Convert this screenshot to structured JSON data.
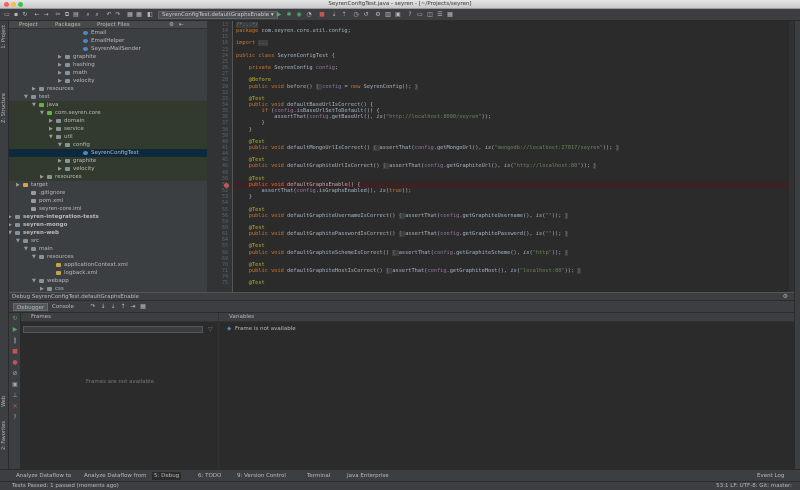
{
  "window": {
    "title": "SeyrenConfigTest.java - seyren - [~/Projects/seyren]"
  },
  "toolbar": {
    "run_config": "SeyrenConfigTest.defaultGraphsEnable ▾"
  },
  "left_strip": {
    "project_tab": "1: Project",
    "structure_tab": "Z: Structure",
    "web_tab": "Web",
    "favorites_tab": "2: Favorites"
  },
  "project_panel": {
    "tabs": [
      "Project",
      "Packages",
      "Project Files"
    ],
    "tree": [
      {
        "label": "Email",
        "indent": 74,
        "type": "class"
      },
      {
        "label": "EmailHelper",
        "indent": 74,
        "type": "class"
      },
      {
        "label": "SeyrenMailSender",
        "indent": 74,
        "type": "class"
      },
      {
        "label": "graphite",
        "indent": 56,
        "type": "folder",
        "arrow": "▶"
      },
      {
        "label": "hashing",
        "indent": 56,
        "type": "folder",
        "arrow": "▶"
      },
      {
        "label": "math",
        "indent": 56,
        "type": "folder",
        "arrow": "▶"
      },
      {
        "label": "velocity",
        "indent": 56,
        "type": "folder",
        "arrow": "▶"
      },
      {
        "label": "resources",
        "indent": 30,
        "type": "folder",
        "arrow": "▶"
      },
      {
        "label": "test",
        "indent": 22,
        "type": "folder",
        "arrow": "▼"
      },
      {
        "label": "java",
        "indent": 30,
        "type": "folder-green",
        "arrow": "▼",
        "hl": true
      },
      {
        "label": "com.seyren.core",
        "indent": 38,
        "type": "folder-green",
        "arrow": "▼",
        "hl": true
      },
      {
        "label": "domain",
        "indent": 47,
        "type": "folder",
        "arrow": "▶",
        "hl": true
      },
      {
        "label": "service",
        "indent": 47,
        "type": "folder",
        "arrow": "▶",
        "hl": true
      },
      {
        "label": "util",
        "indent": 47,
        "type": "folder",
        "arrow": "▼",
        "hl": true
      },
      {
        "label": "config",
        "indent": 56,
        "type": "folder",
        "arrow": "▼",
        "hl": true
      },
      {
        "label": "SeyrenConfigTest",
        "indent": 74,
        "type": "test-class",
        "sel": true
      },
      {
        "label": "graphite",
        "indent": 56,
        "type": "folder",
        "arrow": "▶",
        "hl": true
      },
      {
        "label": "velocity",
        "indent": 56,
        "type": "folder",
        "arrow": "▶",
        "hl": true
      },
      {
        "label": "resources",
        "indent": 38,
        "type": "folder",
        "arrow": "▶",
        "hl": true
      },
      {
        "label": "target",
        "indent": 14,
        "type": "folder-orange",
        "arrow": "▶"
      },
      {
        "label": ".gitignore",
        "indent": 22,
        "type": "file"
      },
      {
        "label": "pom.xml",
        "indent": 22,
        "type": "file"
      },
      {
        "label": "seyren-core.iml",
        "indent": 22,
        "type": "file"
      },
      {
        "label": "seyren-integration-tests",
        "indent": 6,
        "type": "module",
        "arrow": "▶",
        "bold": true
      },
      {
        "label": "seyren-mongo",
        "indent": 6,
        "type": "module",
        "arrow": "▶",
        "bold": true
      },
      {
        "label": "seyren-web",
        "indent": 6,
        "type": "module",
        "arrow": "▼",
        "bold": true
      },
      {
        "label": "src",
        "indent": 14,
        "type": "folder",
        "arrow": "▼"
      },
      {
        "label": "main",
        "indent": 22,
        "type": "folder",
        "arrow": "▼"
      },
      {
        "label": "resources",
        "indent": 30,
        "type": "folder",
        "arrow": "▼"
      },
      {
        "label": "applicationContext.xml",
        "indent": 47,
        "type": "xml"
      },
      {
        "label": "logback.xml",
        "indent": 47,
        "type": "xml"
      },
      {
        "label": "webapp",
        "indent": 30,
        "type": "folder",
        "arrow": "▼"
      },
      {
        "label": "css",
        "indent": 38,
        "type": "folder",
        "arrow": "▶"
      }
    ]
  },
  "editor": {
    "lines": [
      {
        "n": "13",
        "html": "<span class=\"inl\">/*...*/</span>"
      },
      {
        "n": "14",
        "html": "<span class=\"kw\">package</span> com.seyren.core.util.config;"
      },
      {
        "n": "15",
        "html": ""
      },
      {
        "n": "16",
        "html": "<span class=\"kw\">import</span> <span class=\"inl\">...</span>"
      },
      {
        "n": "23",
        "html": ""
      },
      {
        "n": "24",
        "html": "<span class=\"kw\">public class</span> SeyrenConfigTest {"
      },
      {
        "n": "25",
        "html": ""
      },
      {
        "n": "26",
        "html": "    <span class=\"kw\">private</span> SeyrenConfig <span class=\"fld\">config</span>;"
      },
      {
        "n": "27",
        "html": ""
      },
      {
        "n": "28",
        "html": "    <span class=\"ann\">@Before</span>"
      },
      {
        "n": "29",
        "html": "    <span class=\"kw\">public void</span> before() <span class=\"inl\">{ </span><span class=\"fld\">config</span> = <span class=\"kw\">new</span> SeyrenConfig(); <span class=\"inl\">}</span>"
      },
      {
        "n": "32",
        "html": ""
      },
      {
        "n": "33",
        "html": "    <span class=\"ann\">@Test</span>"
      },
      {
        "n": "34",
        "html": "    <span class=\"kw\">public void</span> defaultBaseUrlIsCorrect() {"
      },
      {
        "n": "35",
        "html": "        <span class=\"kw\">if</span> (<span class=\"fld\">config</span>.isBaseUrlSetToDefault()) {"
      },
      {
        "n": "36",
        "html": "            assertThat(<span class=\"fld\">config</span>.getBaseUrl(), <i>is</i>(<span class=\"str\">\"http://localhost:8080/seyren\"</span>));"
      },
      {
        "n": "37",
        "html": "        }"
      },
      {
        "n": "38",
        "html": "    }"
      },
      {
        "n": "39",
        "html": ""
      },
      {
        "n": "40",
        "html": "    <span class=\"ann\">@Test</span>"
      },
      {
        "n": "41",
        "html": "    <span class=\"kw\">public void</span> defaultMongoUrlIsCorrect() <span class=\"inl\">{ </span>assertThat(<span class=\"fld\">config</span>.getMongoUrl(), <i>is</i>(<span class=\"str\">\"mongodb://localhost:27017/seyren\"</span>)); <span class=\"inl\">}</span>"
      },
      {
        "n": "44",
        "html": ""
      },
      {
        "n": "45",
        "html": "    <span class=\"ann\">@Test</span>"
      },
      {
        "n": "46",
        "html": "    <span class=\"kw\">public void</span> defaultGraphiteUrlIsCorrect() <span class=\"inl\">{ </span>assertThat(<span class=\"fld\">config</span>.getGraphiteUrl(), <i>is</i>(<span class=\"str\">\"http://localhost:80\"</span>)); <span class=\"inl\">}</span>"
      },
      {
        "n": "49",
        "html": ""
      },
      {
        "n": "50",
        "html": "    <span class=\"ann\">@Test</span>"
      },
      {
        "n": "51",
        "html": "    <span class=\"kw\">public void</span> defaultGraphsEnable() {"
      },
      {
        "n": "52",
        "html": "        assertThat(<span class=\"fld\">config</span>.isGraphsEnabled(), <i>is</i>(<span class=\"kw\">true</span>));"
      },
      {
        "n": "53",
        "html": "    }"
      },
      {
        "n": "54",
        "html": ""
      },
      {
        "n": "55",
        "html": "    <span class=\"ann\">@Test</span>"
      },
      {
        "n": "56",
        "html": "    <span class=\"kw\">public void</span> defaultGraphiteUsernameIsCorrect() <span class=\"inl\">{ </span>assertThat(<span class=\"fld\">config</span>.getGraphiteUsername(), <i>is</i>(<span class=\"str\">\"\"</span>)); <span class=\"inl\">}</span>"
      },
      {
        "n": "59",
        "html": ""
      },
      {
        "n": "60",
        "html": "    <span class=\"ann\">@Test</span>"
      },
      {
        "n": "61",
        "html": "    <span class=\"kw\">public void</span> defaultGraphitePasswordIsCorrect() <span class=\"inl\">{ </span>assertThat(<span class=\"fld\">config</span>.getGraphitePassword(), <i>is</i>(<span class=\"str\">\"\"</span>)); <span class=\"inl\">}</span>"
      },
      {
        "n": "64",
        "html": ""
      },
      {
        "n": "65",
        "html": "    <span class=\"ann\">@Test</span>"
      },
      {
        "n": "66",
        "html": "    <span class=\"kw\">public void</span> defaultGraphiteSchemeIsCorrect() <span class=\"inl\">{ </span>assertThat(<span class=\"fld\">config</span>.getGraphiteScheme(), <i>is</i>(<span class=\"str\">\"http\"</span>)); <span class=\"inl\">}</span>"
      },
      {
        "n": "69",
        "html": ""
      },
      {
        "n": "70",
        "html": "    <span class=\"ann\">@Test</span>"
      },
      {
        "n": "71",
        "html": "    <span class=\"kw\">public void</span> defaultGraphiteHostIsCorrect() <span class=\"inl\">{ </span>assertThat(<span class=\"fld\">config</span>.getGraphiteHost(), <i>is</i>(<span class=\"str\">\"localhost:80\"</span>)); <span class=\"inl\">}</span>"
      },
      {
        "n": "74",
        "html": ""
      },
      {
        "n": "75",
        "html": "    <span class=\"ann\">@Test</span>"
      }
    ]
  },
  "debug": {
    "title": "Debug  SeyrenConfigTest.defaultGraphsEnable",
    "tabs": [
      "Debugger",
      "Console"
    ],
    "frames_label": "Frames",
    "frames_empty": "Frames are not available",
    "variables_label": "Variables",
    "variables_msg": "Frame is not available"
  },
  "bottom_tools": {
    "items": [
      "Analyze Dataflow to",
      "Analyze Dataflow from",
      "5: Debug",
      "6: TODO",
      "9: Version Control",
      "Terminal",
      "Java Enterprise"
    ],
    "event_log": "Event Log"
  },
  "status": {
    "text": "Tests Passed: 1 passed (moments ago)",
    "right": "53:1  LF:  UTF-8:  Git: master:"
  },
  "colors": {
    "accent": "#4a88c7",
    "background": "#2b2b2b",
    "panel": "#3c3f41",
    "selection": "#0d293e"
  }
}
